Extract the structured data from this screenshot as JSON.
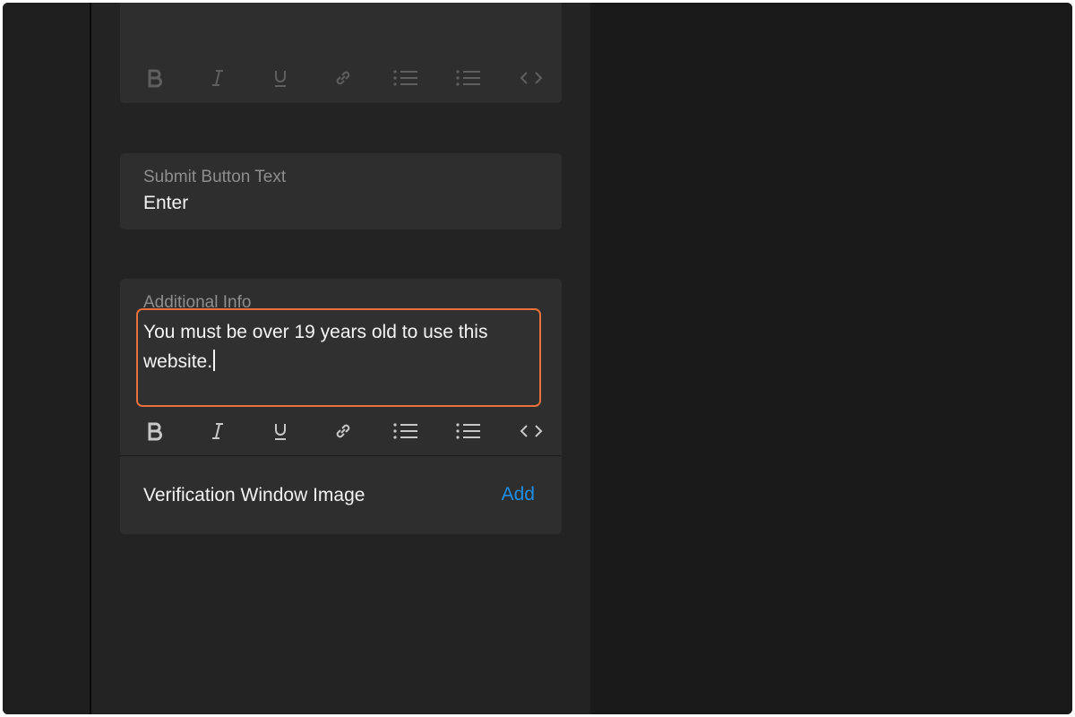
{
  "top_card": {
    "toolbar": [
      "bold-icon",
      "italic-icon",
      "underline-icon",
      "link-icon",
      "ordered-list-icon",
      "bullet-list-icon",
      "code-icon"
    ]
  },
  "submit_card": {
    "label": "Submit Button Text",
    "value": "Enter"
  },
  "info_card": {
    "label": "Additional Info",
    "text_line1": "You must be over 19 years old to use this",
    "text_line2": "website.",
    "toolbar": [
      "bold-icon",
      "italic-icon",
      "underline-icon",
      "link-icon",
      "ordered-list-icon",
      "bullet-list-icon",
      "code-icon"
    ],
    "image_label": "Verification Window Image",
    "add_label": "Add"
  },
  "colors": {
    "highlight": "#e8703c",
    "link": "#1e8ee8",
    "panel": "#232323",
    "card": "#2e2e2e"
  }
}
